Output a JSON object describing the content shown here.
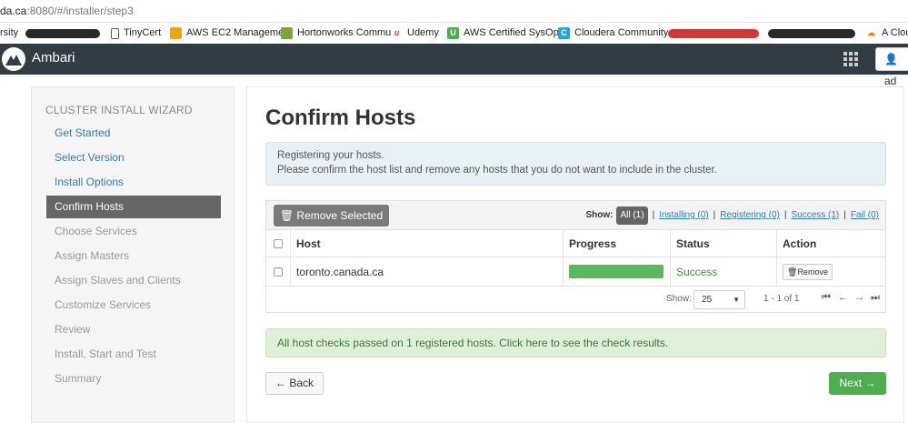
{
  "browser": {
    "url_host": "da.ca",
    "url_path": ":8080/#/installer/step3",
    "bookmarks": [
      {
        "label": "rsity",
        "icon": "bookmark-icon"
      },
      {
        "label": "TinyCert",
        "icon": "page-icon"
      },
      {
        "label": "AWS EC2 Manageme",
        "icon": "aws-icon"
      },
      {
        "label": "Hortonworks Commu",
        "icon": "hortonworks-icon"
      },
      {
        "label": "Udemy",
        "icon": "udemy-icon"
      },
      {
        "label": "AWS Certified SysOp",
        "icon": "u-icon"
      },
      {
        "label": "Cloudera Community",
        "icon": "cloudera-icon"
      },
      {
        "label": "A Clou",
        "icon": "cloud-icon"
      }
    ]
  },
  "header": {
    "brand": "Ambari",
    "user_label": "ad",
    "colors": {
      "bar": "#313d43"
    }
  },
  "sidebar": {
    "title": "CLUSTER INSTALL WIZARD",
    "items": [
      {
        "label": "Get Started",
        "state": "done"
      },
      {
        "label": "Select Version",
        "state": "done"
      },
      {
        "label": "Install Options",
        "state": "done"
      },
      {
        "label": "Confirm Hosts",
        "state": "active"
      },
      {
        "label": "Choose Services",
        "state": "todo"
      },
      {
        "label": "Assign Masters",
        "state": "todo"
      },
      {
        "label": "Assign Slaves and Clients",
        "state": "todo"
      },
      {
        "label": "Customize Services",
        "state": "todo"
      },
      {
        "label": "Review",
        "state": "todo"
      },
      {
        "label": "Install, Start and Test",
        "state": "todo"
      },
      {
        "label": "Summary",
        "state": "todo"
      }
    ]
  },
  "main": {
    "title": "Confirm Hosts",
    "info_line1": "Registering your hosts.",
    "info_line2": "Please confirm the host list and remove any hosts that you do not want to include in the cluster.",
    "remove_selected": "Remove Selected",
    "filters": {
      "show_label": "Show:",
      "all": "All (1)",
      "installing": "Installing (0)",
      "registering": "Registering (0)",
      "success": "Success (1)",
      "fail": "Fail (0)"
    },
    "table": {
      "columns": [
        "Host",
        "Progress",
        "Status",
        "Action"
      ],
      "rows": [
        {
          "host": "toronto.canada.ca",
          "progress": 1.0,
          "status": "Success",
          "action": "Remove"
        }
      ]
    },
    "pager": {
      "show_label": "Show:",
      "page_size": "25",
      "range": "1 - 1 of 1"
    },
    "checks_text": "All host checks passed on 1 registered hosts.",
    "checks_link": "Click here to see the check results.",
    "back": "← Back",
    "next": "Next →"
  }
}
